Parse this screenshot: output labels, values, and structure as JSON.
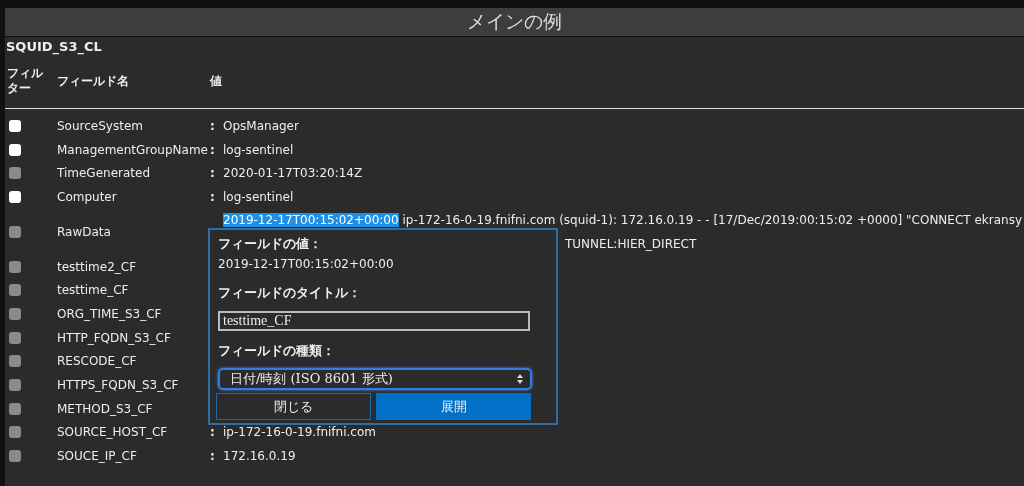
{
  "header": {
    "title": "メインの例"
  },
  "table": {
    "name": "SQUID_S3_CL",
    "columns": [
      "フィルター",
      "フィールド名",
      "値"
    ],
    "rows": [
      {
        "field": "SourceSystem",
        "checked": false,
        "disabled": false,
        "separator": ":",
        "value": "OpsManager"
      },
      {
        "field": "ManagementGroupName",
        "checked": false,
        "disabled": false,
        "separator": ":",
        "value": "log-sentinel"
      },
      {
        "field": "TimeGenerated",
        "checked": false,
        "disabled": true,
        "separator": ":",
        "value": "2020-01-17T03:20:14Z"
      },
      {
        "field": "Computer",
        "checked": false,
        "disabled": false,
        "separator": ":",
        "value": "log-sentinel"
      },
      {
        "field": "RawData",
        "checked": false,
        "disabled": true,
        "value_selected": "2019-12-17T00:15:02+00:00",
        "value": " ip-172-16-0-19.fnifni.com (squid-1): 172.16.0.19 - - [17/Dec/2019:00:15:02 +0000] \"CONNECT ekransy",
        "value_line_2": "TUNNEL:HIER_DIRECT"
      },
      {
        "field": "testtime2_CF",
        "checked": false,
        "disabled": true
      },
      {
        "field": "testtime_CF",
        "checked": false,
        "disabled": true
      },
      {
        "field": "ORG_TIME_S3_CF",
        "checked": false,
        "disabled": true
      },
      {
        "field": "HTTP_FQDN_S3_CF",
        "checked": false,
        "disabled": true
      },
      {
        "field": "RESCODE_CF",
        "checked": false,
        "disabled": true
      },
      {
        "field": "HTTPS_FQDN_S3_CF",
        "checked": false,
        "disabled": true
      },
      {
        "field": "METHOD_S3_CF",
        "checked": false,
        "disabled": true
      },
      {
        "field": "SOURCE_HOST_CF",
        "checked": false,
        "disabled": true,
        "separator": ":",
        "value": "ip-172-16-0-19.fnifni.com"
      },
      {
        "field": "SOUCE_IP_CF",
        "checked": false,
        "disabled": true,
        "separator": ":",
        "value": "172.16.0.19"
      }
    ]
  },
  "popup": {
    "value_label": "フィールドの値：",
    "value": "2019-12-17T00:15:02+00:00",
    "title_label": "フィールドのタイトル：",
    "title_value": "testtime_CF",
    "type_label": "フィールドの種類：",
    "type_value": "日付/時刻 (ISO 8601 形式)",
    "buttons": [
      {
        "label": "閉じる",
        "kind": "secondary"
      },
      {
        "label": "展開",
        "kind": "primary"
      }
    ]
  }
}
